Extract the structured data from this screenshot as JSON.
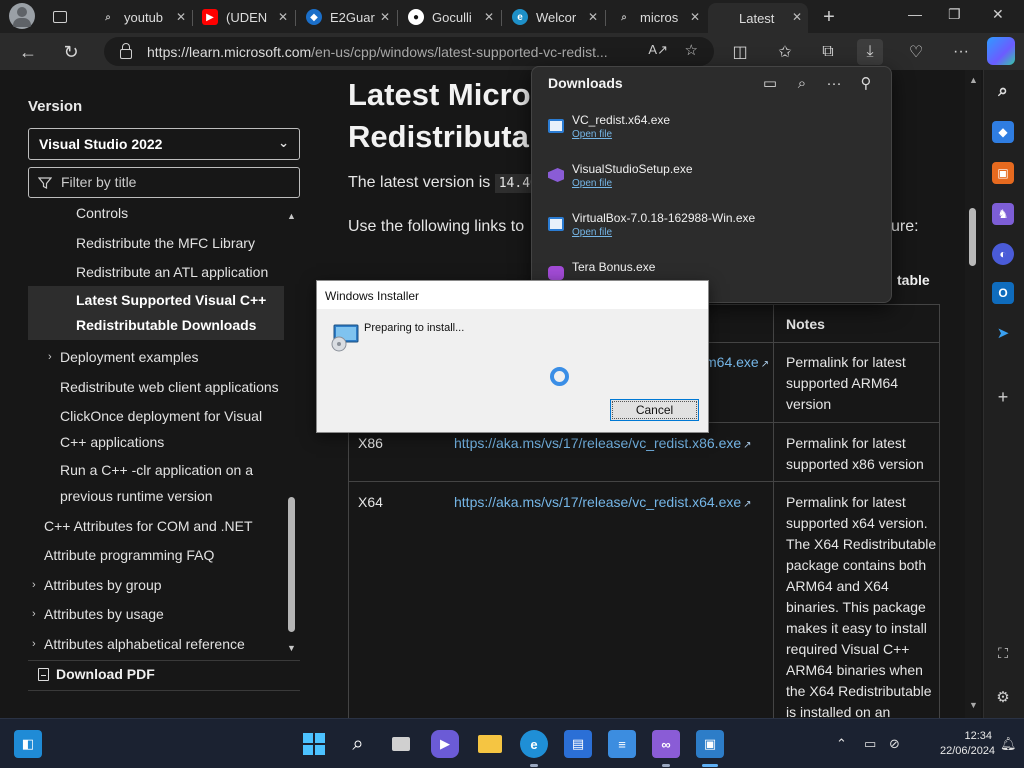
{
  "tabs": [
    {
      "title": "youtub",
      "favicon": "search-icon",
      "color": "#3b3b3b"
    },
    {
      "title": "(UDEN",
      "favicon": "youtube-icon",
      "color": "#ff0000"
    },
    {
      "title": "E2Guar",
      "favicon": "e2guard-icon",
      "color": "#1b6fc9"
    },
    {
      "title": "Goculli",
      "favicon": "github-icon",
      "color": "#ffffff"
    },
    {
      "title": "Welcor",
      "favicon": "edge-icon",
      "color": "#1e90c8"
    },
    {
      "title": "micros",
      "favicon": "search-icon",
      "color": "#3b3b3b"
    },
    {
      "title": "Latest",
      "favicon": "microsoft-icon",
      "color": "#f25022",
      "active": true
    }
  ],
  "address": {
    "url_host": "https://learn.microsoft.com",
    "url_path": "/en-us/cpp/windows/latest-supported-vc-redist..."
  },
  "nav": {
    "version_label": "Version",
    "version_selected": "Visual Studio 2022",
    "filter_placeholder": "Filter by title",
    "toc": [
      {
        "label": "Controls",
        "indent": 48
      },
      {
        "label": "Redistribute the MFC Library",
        "indent": 48
      },
      {
        "label": "Redistribute an ATL application",
        "indent": 48
      },
      {
        "label": "Latest Supported Visual C++",
        "label2": "Redistributable Downloads",
        "indent": 48,
        "selected": true
      },
      {
        "label": "Deployment examples",
        "indent": 32,
        "arrow": true
      },
      {
        "label": "Redistribute web client applications",
        "indent": 32
      },
      {
        "label": "ClickOnce deployment for Visual",
        "label2": "C++ applications",
        "indent": 32
      },
      {
        "label": "Run a C++ -clr application on a",
        "label2": "previous runtime version",
        "indent": 32
      },
      {
        "label": "C++ Attributes for COM and .NET",
        "indent": 16
      },
      {
        "label": "Attribute programming FAQ",
        "indent": 16
      },
      {
        "label": "Attributes by group",
        "indent": 16,
        "arrow": true
      },
      {
        "label": "Attributes by usage",
        "indent": 16,
        "arrow": true
      },
      {
        "label": "Attributes alphabetical reference",
        "indent": 16,
        "arrow": true
      }
    ],
    "download_pdf": "Download PDF"
  },
  "article": {
    "title_line1": "Latest Micro",
    "title_line2": "Redistributal",
    "latest_prefix": "The latest version is ",
    "latest_code": "14.40",
    "links_prefix": "Use the following links to",
    "links_suffix": "ure:",
    "table_word": "table",
    "notes_header": "Notes",
    "rows": [
      {
        "arch": "",
        "link": "m64.exe",
        "notes": [
          "Permalink for latest",
          "supported ARM64",
          "version"
        ]
      },
      {
        "arch": "X86",
        "link": "https://aka.ms/vs/17/release/vc_redist.x86.exe",
        "notes": [
          "Permalink for latest",
          "supported x86 version"
        ]
      },
      {
        "arch": "X64",
        "link": "https://aka.ms/vs/17/release/vc_redist.x64.exe",
        "notes": [
          "Permalink for latest",
          "supported x64 version.",
          "The X64 Redistributable",
          "package contains both",
          "ARM64 and X64",
          "binaries. This package",
          "makes it easy to install",
          "required Visual C++",
          "ARM64 binaries when",
          "the X64 Redistributable",
          "is installed on an"
        ]
      }
    ]
  },
  "downloads": {
    "title": "Downloads",
    "items": [
      {
        "name": "VC_redist.x64.exe",
        "action": "Open file",
        "icon_color": "#2b7cd3"
      },
      {
        "name": "VisualStudioSetup.exe",
        "action": "Open file",
        "icon_color": "#8a5cd6"
      },
      {
        "name": "VirtualBox-7.0.18-162988-Win.exe",
        "action": "Open file",
        "icon_color": "#2b7cd3"
      },
      {
        "name": "Tera Bonus.exe",
        "action": "",
        "icon_color": "#a24bd6"
      }
    ]
  },
  "installer": {
    "title": "Windows Installer",
    "message": "Preparing to install...",
    "cancel": "Cancel"
  },
  "tray": {
    "time": "12:34",
    "date": "22/06/2024"
  }
}
